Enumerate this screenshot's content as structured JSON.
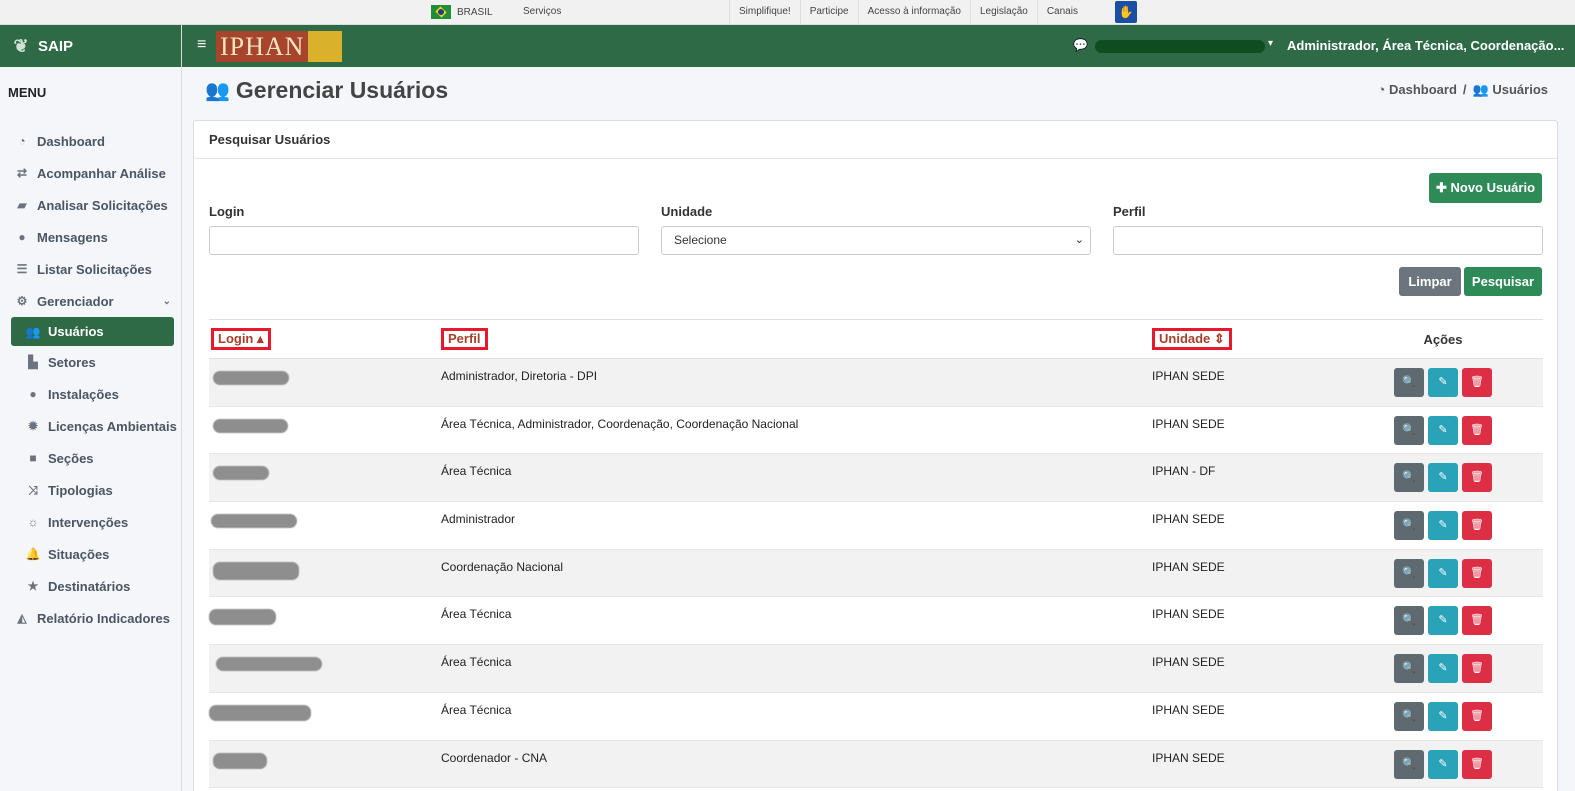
{
  "gov_bar": {
    "brasil": "BRASIL",
    "servicos": "Serviços",
    "links": [
      "Simplifique!",
      "Participe",
      "Acesso à informação",
      "Legislação",
      "Canais"
    ]
  },
  "brand": {
    "name": "SAIP"
  },
  "header": {
    "logo_text": "IPHAN",
    "user_role": "Administrador, Área Técnica, Coordenação..."
  },
  "sidebar": {
    "menu_title": "MENU",
    "items": [
      {
        "label": "Dashboard",
        "icon": "dashboard-icon"
      },
      {
        "label": "Acompanhar Análise",
        "icon": "exchange-icon"
      },
      {
        "label": "Analisar Solicitações",
        "icon": "book-icon"
      },
      {
        "label": "Mensagens",
        "icon": "comments-icon"
      },
      {
        "label": "Listar Solicitações",
        "icon": "list-icon"
      },
      {
        "label": "Gerenciador",
        "icon": "cogs-icon"
      },
      {
        "label": "Usuários",
        "icon": "users-icon"
      },
      {
        "label": "Setores",
        "icon": "chart-icon"
      },
      {
        "label": "Instalações",
        "icon": "circle-icon"
      },
      {
        "label": "Licenças Ambientais",
        "icon": "certificate-icon"
      },
      {
        "label": "Seções",
        "icon": "square-icon"
      },
      {
        "label": "Tipologias",
        "icon": "random-icon"
      },
      {
        "label": "Intervenções",
        "icon": "sun-icon"
      },
      {
        "label": "Situações",
        "icon": "bell-icon"
      },
      {
        "label": "Destinatários",
        "icon": "star-icon"
      },
      {
        "label": "Relatório Indicadores",
        "icon": "area-chart-icon"
      }
    ]
  },
  "page": {
    "title": "Gerenciar Usuários",
    "breadcrumb": [
      "Dashboard",
      "/",
      "Usuários"
    ]
  },
  "search": {
    "card_title": "Pesquisar Usuários",
    "new_button": "Novo Usuário",
    "login_label": "Login",
    "login_value": "",
    "unidade_label": "Unidade",
    "unidade_selected": "Selecione",
    "perfil_label": "Perfil",
    "perfil_value": "",
    "clear_button": "Limpar",
    "search_button": "Pesquisar"
  },
  "table": {
    "columns": [
      "Login",
      "Perfil",
      "Unidade",
      "Ações"
    ],
    "rows": [
      {
        "perfil": "Administrador, Diretoria - DPI",
        "unidade": "IPHAN SEDE"
      },
      {
        "perfil": "Área Técnica, Administrador, Coordenação, Coordenação Nacional",
        "unidade": "IPHAN SEDE"
      },
      {
        "perfil": "Área Técnica",
        "unidade": "IPHAN - DF"
      },
      {
        "perfil": "Administrador",
        "unidade": "IPHAN SEDE"
      },
      {
        "perfil": "Coordenação Nacional",
        "unidade": "IPHAN SEDE"
      },
      {
        "perfil": "Área Técnica",
        "unidade": "IPHAN SEDE"
      },
      {
        "perfil": "Área Técnica",
        "unidade": "IPHAN SEDE"
      },
      {
        "perfil": "Área Técnica",
        "unidade": "IPHAN SEDE"
      },
      {
        "perfil": "Coordenador - CNA",
        "unidade": "IPHAN SEDE"
      }
    ]
  },
  "colors": {
    "primary_green": "#2d6a45",
    "button_green": "#2e8b57",
    "danger": "#dc2f45",
    "info": "#2aa3b8",
    "highlight": "#e8192c"
  }
}
